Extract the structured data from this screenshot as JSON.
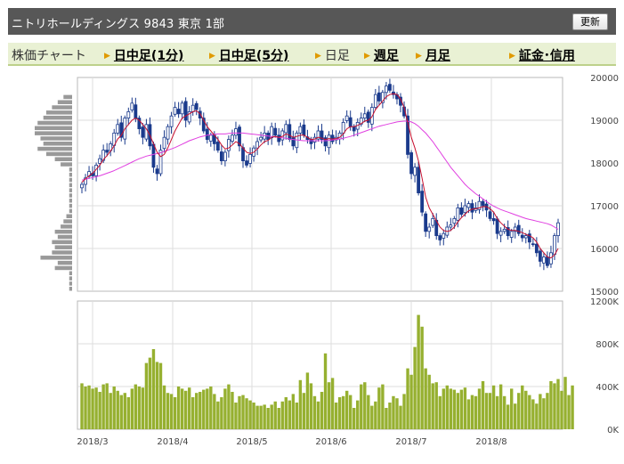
{
  "header": {
    "title": "ニトリホールディングス  9843  東京 1部",
    "refresh_label": "更新"
  },
  "nav": {
    "label": "株価チャート",
    "items": [
      {
        "label": "日中足(1分)",
        "link": true
      },
      {
        "label": "日中足(5分)",
        "link": true
      },
      {
        "label": "日足",
        "link": false
      },
      {
        "label": "週足",
        "link": true
      },
      {
        "label": "月足",
        "link": true
      },
      {
        "label": "証金･信用",
        "link": true
      }
    ]
  },
  "colors": {
    "candle": "#1a3a8c",
    "ma_short": "#c8102e",
    "ma_long": "#e040e0",
    "volume": "#96b030",
    "vol_profile": "#999999"
  },
  "chart_data": [
    {
      "type": "candlestick",
      "title": "",
      "x_ticks": [
        "2018/3",
        "2018/4",
        "2018/5",
        "2018/6",
        "2018/7",
        "2018/8"
      ],
      "y_ticks": [
        "20000",
        "19000",
        "18000",
        "17000",
        "16000",
        "15000"
      ],
      "ylim": [
        15000,
        20000
      ],
      "closes": [
        17500,
        17650,
        17800,
        17700,
        17950,
        18100,
        18300,
        18250,
        18450,
        18700,
        18900,
        18600,
        19050,
        19200,
        19400,
        19050,
        18800,
        18600,
        18900,
        18400,
        17900,
        17750,
        18300,
        18600,
        18850,
        19100,
        19300,
        19150,
        19400,
        19000,
        19200,
        19350,
        19250,
        19050,
        18750,
        18550,
        18650,
        18450,
        18300,
        18050,
        18250,
        18550,
        18650,
        18800,
        18400,
        18050,
        17950,
        18200,
        18350,
        18500,
        18600,
        18700,
        18550,
        18850,
        18650,
        18500,
        18750,
        18900,
        18550,
        18400,
        18700,
        18850,
        18650,
        18550,
        18450,
        18600,
        18750,
        18550,
        18400,
        18650,
        18500,
        18600,
        18700,
        18950,
        19100,
        18850,
        18750,
        18950,
        19050,
        19150,
        18950,
        19300,
        19600,
        19450,
        19650,
        19800,
        19700,
        19600,
        19500,
        19350,
        19100,
        18200,
        17750,
        17900,
        17300,
        16850,
        16400,
        16500,
        16700,
        16300,
        16200,
        16350,
        16500,
        16550,
        16700,
        16950,
        16800,
        17000,
        17050,
        16850,
        16950,
        17100,
        17000,
        16900,
        16700,
        16650,
        16350,
        16400,
        16450,
        16300,
        16400,
        16500,
        16350,
        16250,
        16300,
        16150,
        16100,
        15900,
        15700,
        15800,
        15600,
        15900,
        16300,
        16600
      ],
      "ma_short": [
        17550,
        17630,
        17700,
        17760,
        17850,
        17950,
        18080,
        18170,
        18280,
        18400,
        18560,
        18650,
        18800,
        18900,
        19000,
        19050,
        19000,
        18900,
        18800,
        18650,
        18450,
        18250,
        18150,
        18200,
        18350,
        18550,
        18750,
        18900,
        19050,
        19100,
        19150,
        19200,
        19220,
        19150,
        19000,
        18850,
        18750,
        18650,
        18550,
        18420,
        18330,
        18350,
        18420,
        18500,
        18450,
        18350,
        18250,
        18220,
        18250,
        18330,
        18420,
        18500,
        18530,
        18600,
        18620,
        18600,
        18620,
        18680,
        18650,
        18600,
        18620,
        18650,
        18650,
        18600,
        18550,
        18560,
        18600,
        18580,
        18550,
        18570,
        18560,
        18570,
        18600,
        18680,
        18800,
        18850,
        18850,
        18880,
        18920,
        18980,
        19000,
        19080,
        19250,
        19350,
        19450,
        19550,
        19600,
        19620,
        19600,
        19500,
        19300,
        18950,
        18600,
        18350,
        18050,
        17650,
        17200,
        16950,
        16800,
        16650,
        16500,
        16420,
        16400,
        16420,
        16500,
        16620,
        16720,
        16800,
        16880,
        16920,
        16930,
        16950,
        16980,
        16980,
        16930,
        16850,
        16700,
        16600,
        16520,
        16450,
        16420,
        16420,
        16400,
        16370,
        16330,
        16300,
        16250,
        16150,
        16000,
        15900,
        15800,
        15780,
        15850,
        16000
      ],
      "ma_long": [
        17600,
        17620,
        17640,
        17660,
        17680,
        17700,
        17730,
        17760,
        17790,
        17820,
        17860,
        17900,
        17940,
        17980,
        18020,
        18060,
        18100,
        18130,
        18160,
        18180,
        18200,
        18220,
        18240,
        18270,
        18300,
        18330,
        18360,
        18400,
        18440,
        18480,
        18520,
        18550,
        18580,
        18610,
        18630,
        18650,
        18660,
        18670,
        18680,
        18680,
        18680,
        18690,
        18700,
        18700,
        18700,
        18700,
        18690,
        18680,
        18670,
        18660,
        18650,
        18640,
        18630,
        18620,
        18610,
        18600,
        18590,
        18580,
        18560,
        18550,
        18540,
        18530,
        18520,
        18520,
        18520,
        18520,
        18520,
        18520,
        18520,
        18530,
        18540,
        18550,
        18560,
        18580,
        18600,
        18620,
        18650,
        18680,
        18710,
        18740,
        18770,
        18800,
        18830,
        18860,
        18880,
        18900,
        18920,
        18940,
        18960,
        18970,
        18980,
        18980,
        18960,
        18920,
        18860,
        18780,
        18700,
        18600,
        18500,
        18380,
        18260,
        18140,
        18020,
        17900,
        17800,
        17700,
        17600,
        17500,
        17420,
        17350,
        17280,
        17220,
        17160,
        17100,
        17040,
        16990,
        16950,
        16910,
        16880,
        16850,
        16820,
        16790,
        16760,
        16730,
        16700,
        16680,
        16660,
        16640,
        16620,
        16600,
        16580,
        16550,
        16500,
        16450
      ]
    },
    {
      "type": "bar",
      "title": "",
      "y_ticks": [
        "1200K",
        "800K",
        "400K",
        "0K"
      ],
      "ylim": [
        0,
        1200
      ],
      "values": [
        430,
        400,
        410,
        380,
        390,
        350,
        420,
        430,
        340,
        400,
        360,
        320,
        340,
        300,
        380,
        420,
        400,
        390,
        620,
        670,
        750,
        630,
        620,
        410,
        340,
        330,
        300,
        400,
        380,
        360,
        390,
        300,
        340,
        350,
        370,
        380,
        400,
        330,
        260,
        300,
        380,
        420,
        350,
        250,
        310,
        320,
        290,
        270,
        250,
        220,
        220,
        230,
        200,
        230,
        260,
        200,
        260,
        300,
        270,
        330,
        250,
        460,
        340,
        530,
        430,
        310,
        260,
        350,
        710,
        440,
        480,
        250,
        300,
        310,
        360,
        320,
        200,
        270,
        420,
        440,
        320,
        220,
        260,
        390,
        420,
        200,
        250,
        310,
        290,
        220,
        330,
        570,
        510,
        770,
        1070,
        960,
        570,
        510,
        430,
        440,
        310,
        380,
        410,
        380,
        370,
        340,
        370,
        390,
        280,
        320,
        310,
        380,
        450,
        340,
        340,
        410,
        310,
        420,
        310,
        230,
        380,
        240,
        340,
        410,
        360,
        320,
        280,
        240,
        330,
        290,
        340,
        450,
        430,
        470,
        360,
        490,
        320,
        410
      ]
    },
    {
      "type": "bar",
      "title": "",
      "note_values": [
        0,
        0,
        3,
        5,
        7,
        9,
        10,
        12,
        13,
        13,
        11,
        10,
        12,
        9,
        6,
        4,
        1,
        1,
        1,
        1,
        1,
        1,
        1,
        1,
        1,
        2,
        3,
        4,
        6,
        5,
        7,
        6,
        7,
        11,
        5,
        6,
        1,
        1,
        1,
        1
      ]
    }
  ]
}
